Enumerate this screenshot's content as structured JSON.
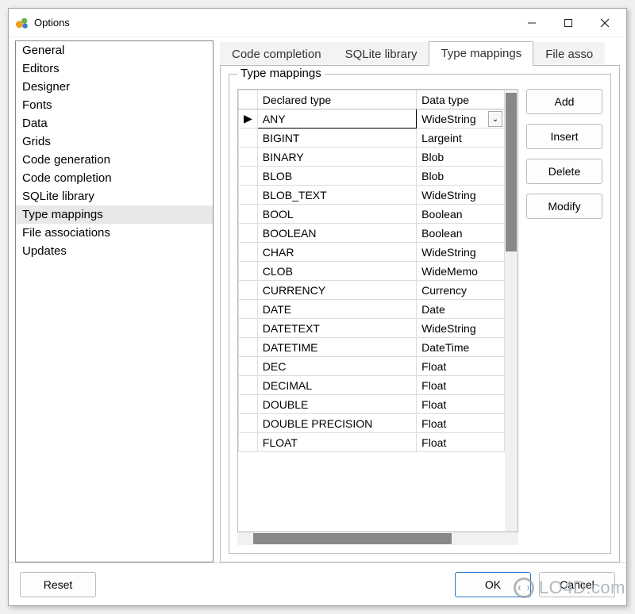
{
  "window": {
    "title": "Options"
  },
  "sidebar": {
    "selected_index": 9,
    "items": [
      "General",
      "Editors",
      "Designer",
      "Fonts",
      "Data",
      "Grids",
      "Code generation",
      "Code completion",
      "SQLite library",
      "Type mappings",
      "File associations",
      "Updates"
    ]
  },
  "tabs": {
    "active_index": 2,
    "items": [
      "Code completion",
      "SQLite library",
      "Type mappings",
      "File asso"
    ]
  },
  "group": {
    "title": "Type mappings"
  },
  "grid": {
    "columns": [
      "Declared type",
      "Data type"
    ],
    "selected_row": 0,
    "rows": [
      {
        "declared": "ANY",
        "data": "WideString"
      },
      {
        "declared": "BIGINT",
        "data": "Largeint"
      },
      {
        "declared": "BINARY",
        "data": "Blob"
      },
      {
        "declared": "BLOB",
        "data": "Blob"
      },
      {
        "declared": "BLOB_TEXT",
        "data": "WideString"
      },
      {
        "declared": "BOOL",
        "data": "Boolean"
      },
      {
        "declared": "BOOLEAN",
        "data": "Boolean"
      },
      {
        "declared": "CHAR",
        "data": "WideString"
      },
      {
        "declared": "CLOB",
        "data": "WideMemo"
      },
      {
        "declared": "CURRENCY",
        "data": "Currency"
      },
      {
        "declared": "DATE",
        "data": "Date"
      },
      {
        "declared": "DATETEXT",
        "data": "WideString"
      },
      {
        "declared": "DATETIME",
        "data": "DateTime"
      },
      {
        "declared": "DEC",
        "data": "Float"
      },
      {
        "declared": "DECIMAL",
        "data": "Float"
      },
      {
        "declared": "DOUBLE",
        "data": "Float"
      },
      {
        "declared": "DOUBLE PRECISION",
        "data": "Float"
      },
      {
        "declared": "FLOAT",
        "data": "Float"
      }
    ]
  },
  "side_buttons": [
    "Add",
    "Insert",
    "Delete",
    "Modify"
  ],
  "bottom": {
    "reset": "Reset",
    "ok": "OK",
    "cancel": "Cancel"
  },
  "watermark": "LO4D.com"
}
